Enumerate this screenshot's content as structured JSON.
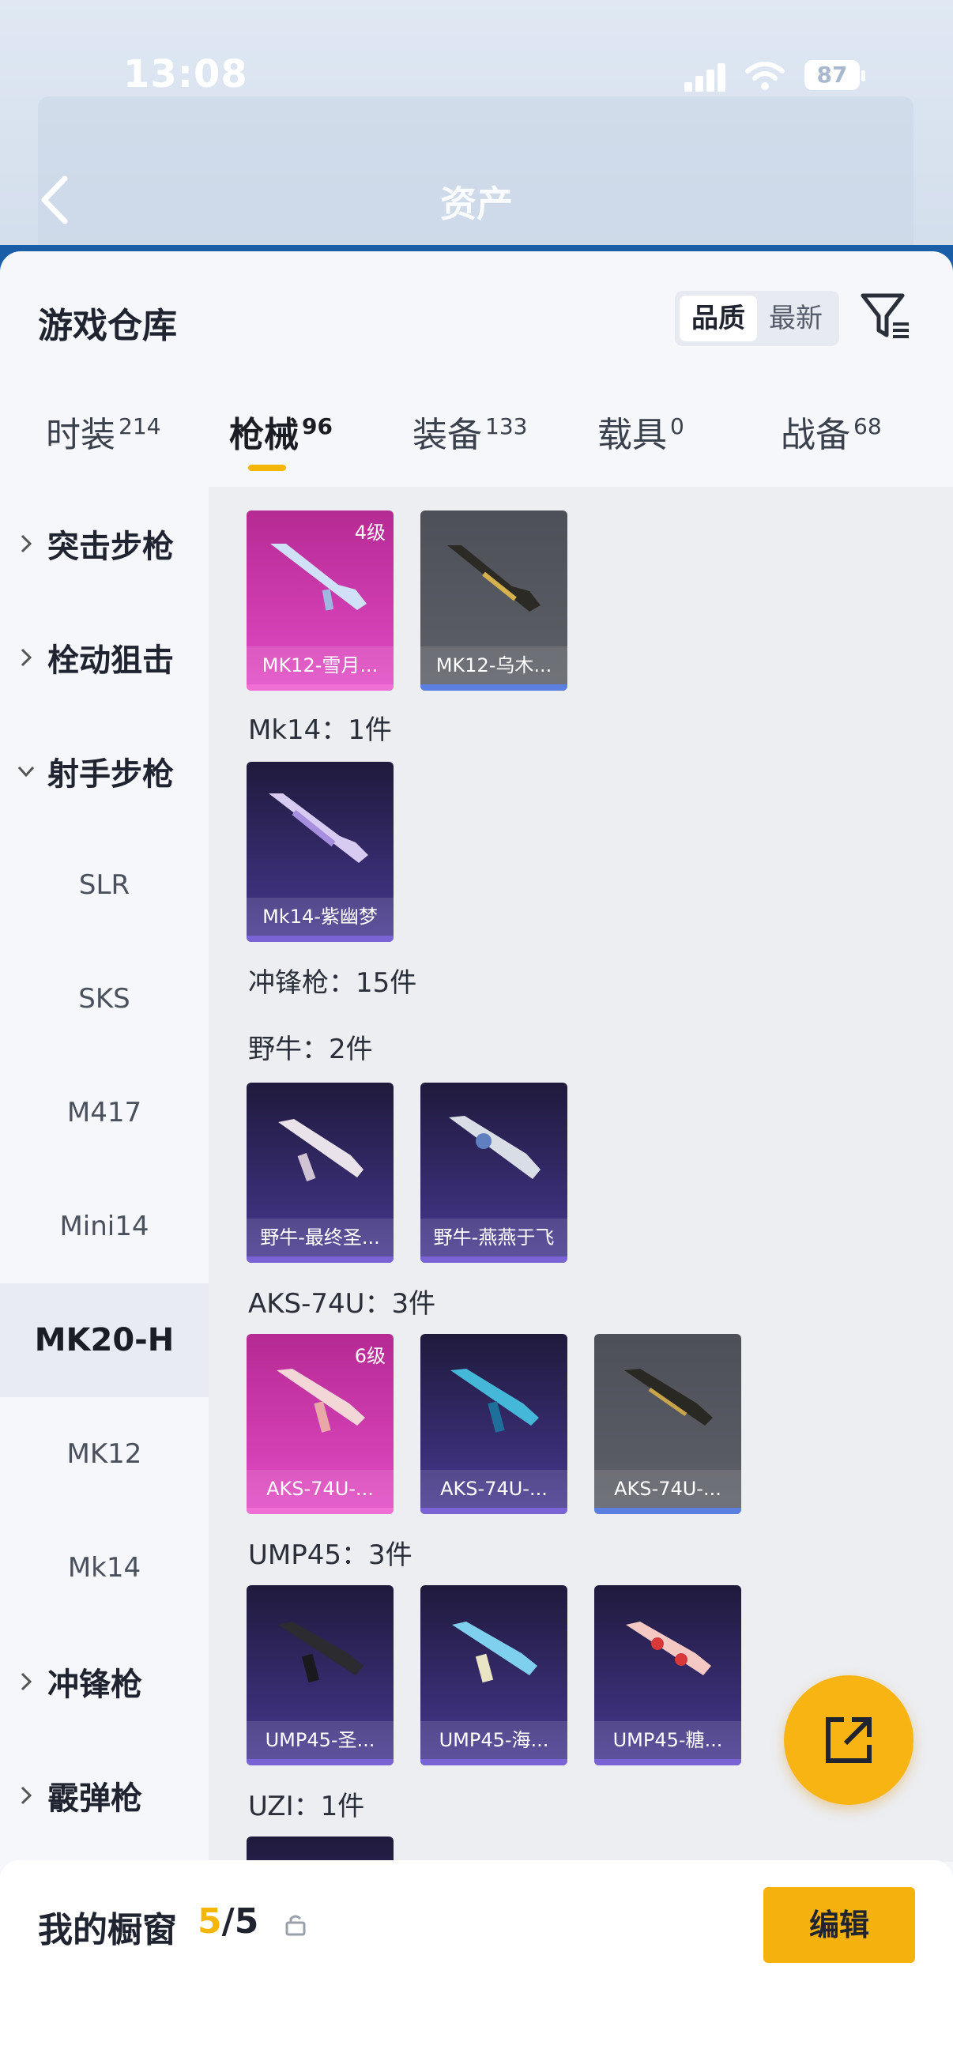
{
  "status": {
    "time": "13:08",
    "battery": "87"
  },
  "header": {
    "title": "资产"
  },
  "sheet": {
    "title": "游戏仓库",
    "sort": {
      "quality": "品质",
      "latest": "最新"
    }
  },
  "tabs": [
    {
      "label": "时装",
      "count": "214"
    },
    {
      "label": "枪械",
      "count": "96"
    },
    {
      "label": "装备",
      "count": "133"
    },
    {
      "label": "载具",
      "count": "0"
    },
    {
      "label": "战备",
      "count": "68"
    }
  ],
  "sidebar": {
    "cats": {
      "assault": "突击步枪",
      "bolt": "栓动狙击",
      "marksman": "射手步枪",
      "smg": "冲锋枪",
      "shotgun": "霰弹枪"
    },
    "subs": {
      "slr": "SLR",
      "sks": "SKS",
      "m417": "M417",
      "mini14": "Mini14",
      "mk20": "MK20-H",
      "mk12": "MK12",
      "mk14": "Mk14"
    }
  },
  "content": {
    "mk12_cards": [
      {
        "name": "MK12-雪月...",
        "level": "4级"
      },
      {
        "name": "MK12-乌木..."
      }
    ],
    "mk14_title": "Mk14：1件",
    "mk14_cards": [
      {
        "name": "Mk14-紫幽梦"
      }
    ],
    "smg_title": "冲锋枪：15件",
    "bison_title": "野牛：2件",
    "bison_cards": [
      {
        "name": "野牛-最终圣..."
      },
      {
        "name": "野牛-燕燕于飞"
      }
    ],
    "aks_title": "AKS-74U：3件",
    "aks_cards": [
      {
        "name": "AKS-74U-...",
        "level": "6级"
      },
      {
        "name": "AKS-74U-..."
      },
      {
        "name": "AKS-74U-..."
      }
    ],
    "ump_title": "UMP45：3件",
    "ump_cards": [
      {
        "name": "UMP45-圣..."
      },
      {
        "name": "UMP45-海..."
      },
      {
        "name": "UMP45-糖..."
      }
    ],
    "uzi_title": "UZI：1件"
  },
  "bottom": {
    "label": "我的橱窗",
    "current": "5",
    "total": "/5",
    "edit": "编辑"
  },
  "colors": {
    "accent": "#f5b60a",
    "pink_card": "#d23cb3",
    "purple_card": "#3b2f78",
    "gray_card": "#55585f"
  }
}
